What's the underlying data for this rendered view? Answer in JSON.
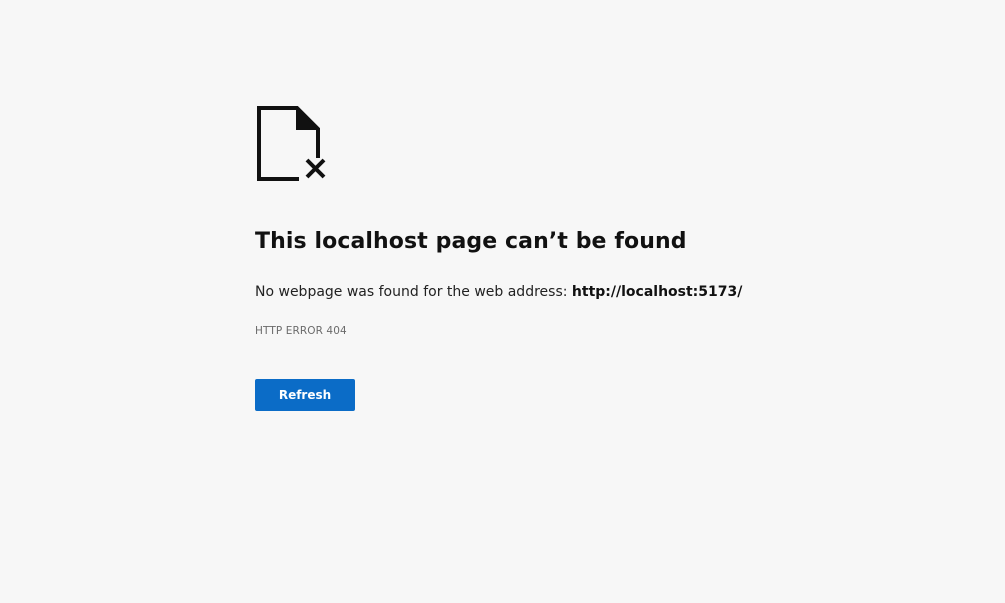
{
  "error_page": {
    "icon": "page-not-found-icon",
    "title": "This localhost page can’t be found",
    "message_prefix": "No webpage was found for the web address: ",
    "url": "http://localhost:5173/",
    "error_code": "HTTP ERROR 404",
    "refresh_label": "Refresh"
  },
  "colors": {
    "background": "#f7f7f7",
    "button": "#0b6cc7",
    "text": "#111111",
    "muted": "#6b6b6b"
  }
}
